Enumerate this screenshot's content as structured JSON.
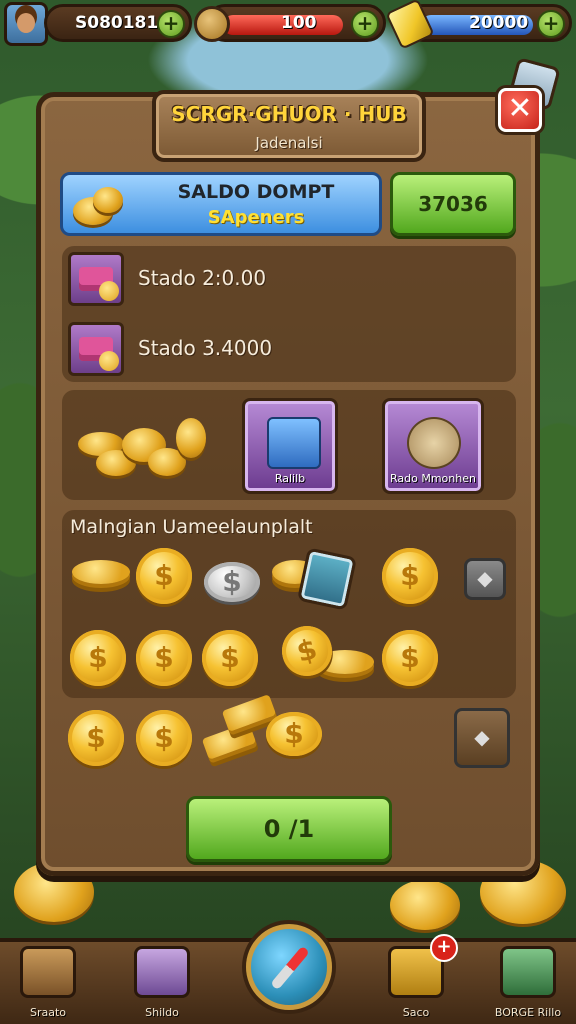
{
  "hud": {
    "currency1": "S080181",
    "energy": "100",
    "currency2": "20000",
    "plus_label": "+"
  },
  "hub": {
    "title": "SCRGR·GHUOR · HUB",
    "subtitle": "Jadenalsi",
    "close_label": "✕"
  },
  "wallet": {
    "line1": "SALDO DOMPT",
    "line2": "SApeners",
    "amount_button": "37036"
  },
  "rows": [
    {
      "text": "Stado 2:0.00"
    },
    {
      "text": "Stado 3.4000"
    }
  ],
  "shop": {
    "card1_caption": "Ralilb",
    "card2_caption": "Rado Mmonhen"
  },
  "coins_section": {
    "title": "Malngian Uameelaunplalt",
    "coin_symbol": "$",
    "lock_symbol": "◆"
  },
  "confirm_button": "0 /1",
  "nav": {
    "items": [
      {
        "label": "Sraato",
        "icon": "treasure-chest-icon"
      },
      {
        "label": "Shildo",
        "icon": "shop-icon"
      },
      {
        "label": "",
        "icon": "compass-icon"
      },
      {
        "label": "Saco",
        "icon": "magnifier-icon"
      },
      {
        "label": "BORGE Rillo",
        "icon": "clipboard-icon"
      }
    ],
    "badge": "+"
  },
  "colors": {
    "panel": "#6f4e2e",
    "accent_gold": "#ffd43b",
    "green": "#52a81e",
    "blue": "#3d8fe0",
    "close_red": "#c6231a"
  }
}
